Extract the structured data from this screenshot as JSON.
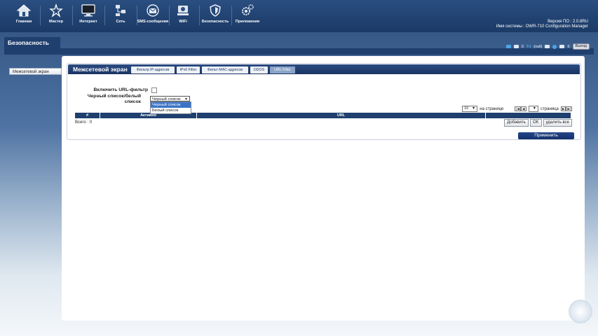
{
  "nav": [
    {
      "label": "Главная",
      "icon": "home-icon"
    },
    {
      "label": "Мастер",
      "icon": "wizard-icon"
    },
    {
      "label": "Интернет",
      "icon": "monitor-icon"
    },
    {
      "label": "Сеть",
      "icon": "network-icon"
    },
    {
      "label": "SMS-сообщения",
      "icon": "envelope-icon"
    },
    {
      "label": "WiFi",
      "icon": "wifi-icon"
    },
    {
      "label": "Безопасность",
      "icon": "shield-icon"
    },
    {
      "label": "Приложения",
      "icon": "gears-icon"
    }
  ],
  "system": {
    "firmware": "Версия ПО : 2.0.8RU",
    "name": "Имя системы : DWR-710 Configuration Manager"
  },
  "status": {
    "sms1": "0",
    "signal": "(null)",
    "sms2": "0",
    "logout": "Выход"
  },
  "section": {
    "title": "Безопасность"
  },
  "sidemenu": {
    "item": "Межсетевой экран"
  },
  "panel": {
    "title": "Межсетевой экран",
    "tabs": [
      "Фильтр IP-адресов",
      "IPv6 Filter",
      "Фильт MAC-адресов",
      "DDOS",
      "URL Filter"
    ],
    "active_tab": "URL Filter"
  },
  "form": {
    "enable_label": "Включить URL-фильтр",
    "list_label_1": "Черный список/белый",
    "list_label_2": "список",
    "list_value": "Черный список",
    "options": [
      "Черный список",
      "Белый список"
    ]
  },
  "pager": {
    "per_page": "10",
    "per_page_label": "на странице",
    "page_label": "страница"
  },
  "table": {
    "headers": [
      "#",
      "Активно",
      "URL",
      ""
    ],
    "total": "Всего : 0"
  },
  "buttons": {
    "add": "Добавить",
    "ok": "OK",
    "delete_all": "удалить все",
    "apply": "Применить"
  }
}
